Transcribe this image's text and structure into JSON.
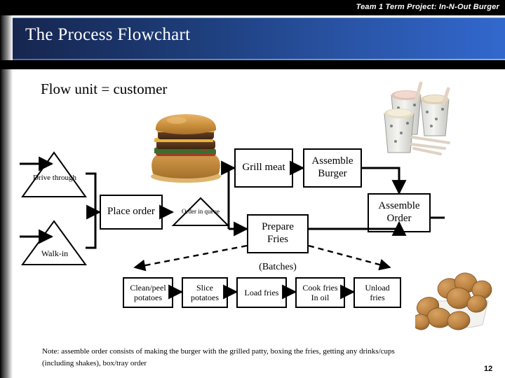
{
  "header": {
    "kicker": "Team 1 Term Project: In-N-Out Burger",
    "title": "The Process Flowchart",
    "accent_dark": "#16264f",
    "accent_light": "#3268cd"
  },
  "body": {
    "flow_unit_heading": "Flow unit = customer",
    "note": "Note: assemble order consists of making the burger with the grilled patty, boxing the fries, getting any drinks/cups (including shakes), box/tray order",
    "page_number": "12"
  },
  "diagram": {
    "triangles": [
      {
        "name": "drive-through",
        "line1": "Drive",
        "line2": "through"
      },
      {
        "name": "walk-in",
        "line1": "Walk-in",
        "line2": ""
      },
      {
        "name": "order-in-queue",
        "line1": "Order in",
        "line2": "queue"
      }
    ],
    "boxes": [
      {
        "name": "place-order",
        "line1": "Place order",
        "line2": ""
      },
      {
        "name": "grill-meat",
        "line1": "Grill meat",
        "line2": ""
      },
      {
        "name": "assemble-burger",
        "line1": "Assemble",
        "line2": "Burger"
      },
      {
        "name": "assemble-order",
        "line1": "Assemble",
        "line2": "Order"
      },
      {
        "name": "prepare-fries",
        "line1": "Prepare",
        "line2": "Fries"
      }
    ],
    "prepare_fries_caption": "(Batches)",
    "subprocess": [
      {
        "name": "clean-peel-potatoes",
        "line1": "Clean/peel",
        "line2": "potatoes"
      },
      {
        "name": "slice-potatoes",
        "line1": "Slice",
        "line2": "potatoes"
      },
      {
        "name": "load-fries",
        "line1": "Load fries",
        "line2": ""
      },
      {
        "name": "cook-fries-in-oil",
        "line1": "Cook fries",
        "line2": "In oil"
      },
      {
        "name": "unload-fries",
        "line1": "Unload",
        "line2": "fries"
      }
    ]
  },
  "images": [
    {
      "name": "burger-photo",
      "alt": "double cheeseburger"
    },
    {
      "name": "milkshakes-photo",
      "alt": "three milkshake cups with spoons"
    },
    {
      "name": "potatoes-photo",
      "alt": "potatoes in a white bowl"
    }
  ]
}
